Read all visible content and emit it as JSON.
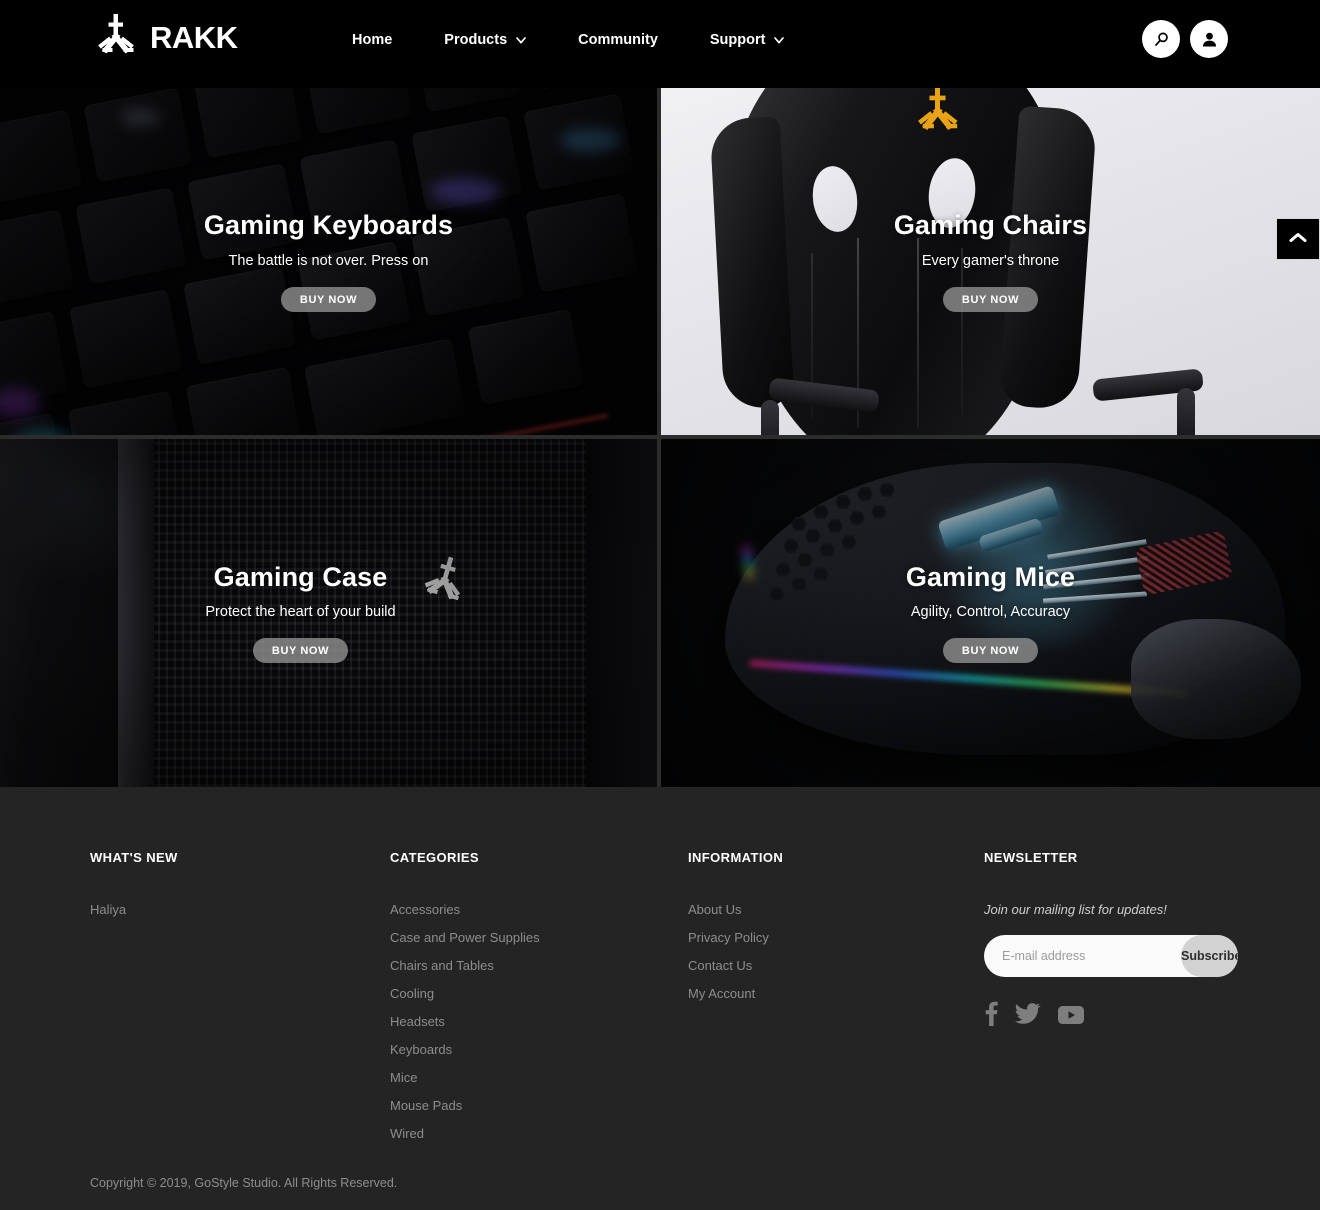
{
  "brand": {
    "name": "RAKK",
    "logo_icon": "rakk-tri-prong-logo",
    "accent_color": "#e8a317"
  },
  "header": {
    "background_color": "#000000",
    "nav": [
      {
        "label": "Home",
        "has_dropdown": false
      },
      {
        "label": "Products",
        "has_dropdown": true,
        "caret_icon": "chevron-down-icon"
      },
      {
        "label": "Community",
        "has_dropdown": false
      },
      {
        "label": "Support",
        "has_dropdown": true,
        "caret_icon": "chevron-down-icon"
      }
    ],
    "actions": [
      {
        "name": "search",
        "icon": "search-icon"
      },
      {
        "name": "account",
        "icon": "user-icon"
      }
    ]
  },
  "scroll_top": {
    "icon": "chevron-up-icon",
    "label": ""
  },
  "tiles": [
    {
      "key": "keyboards",
      "title": "Gaming Keyboards",
      "subtitle": "The battle is not over. Press on",
      "cta": "BUY NOW"
    },
    {
      "key": "chairs",
      "title": "Gaming Chairs",
      "subtitle": "Every gamer's throne",
      "cta": "BUY NOW"
    },
    {
      "key": "case",
      "title": "Gaming Case",
      "subtitle": "Protect the heart of your build",
      "cta": "BUY NOW"
    },
    {
      "key": "mice",
      "title": "Gaming Mice",
      "subtitle": "Agility, Control, Accuracy",
      "cta": "BUY NOW"
    }
  ],
  "footer": {
    "background_color": "#242424",
    "whats_new": {
      "title": "WHAT'S NEW",
      "items": [
        "Haliya"
      ]
    },
    "categories": {
      "title": "CATEGORIES",
      "items": [
        "Accessories",
        "Case and Power Supplies",
        "Chairs and Tables",
        "Cooling",
        "Headsets",
        "Keyboards",
        "Mice",
        "Mouse Pads",
        "Wired"
      ]
    },
    "information": {
      "title": "INFORMATION",
      "items": [
        "About Us",
        "Privacy Policy",
        "Contact Us",
        "My Account"
      ]
    },
    "newsletter": {
      "title": "NEWSLETTER",
      "tagline": "Join our mailing list for updates!",
      "input_placeholder": "E-mail address",
      "input_value": "",
      "button_label": "Subscribe",
      "socials": [
        {
          "name": "facebook",
          "icon": "facebook-icon"
        },
        {
          "name": "twitter",
          "icon": "twitter-icon"
        },
        {
          "name": "youtube",
          "icon": "youtube-icon"
        }
      ]
    },
    "copyright": "Copyright © 2019, GoStyle Studio. All Rights Reserved."
  }
}
